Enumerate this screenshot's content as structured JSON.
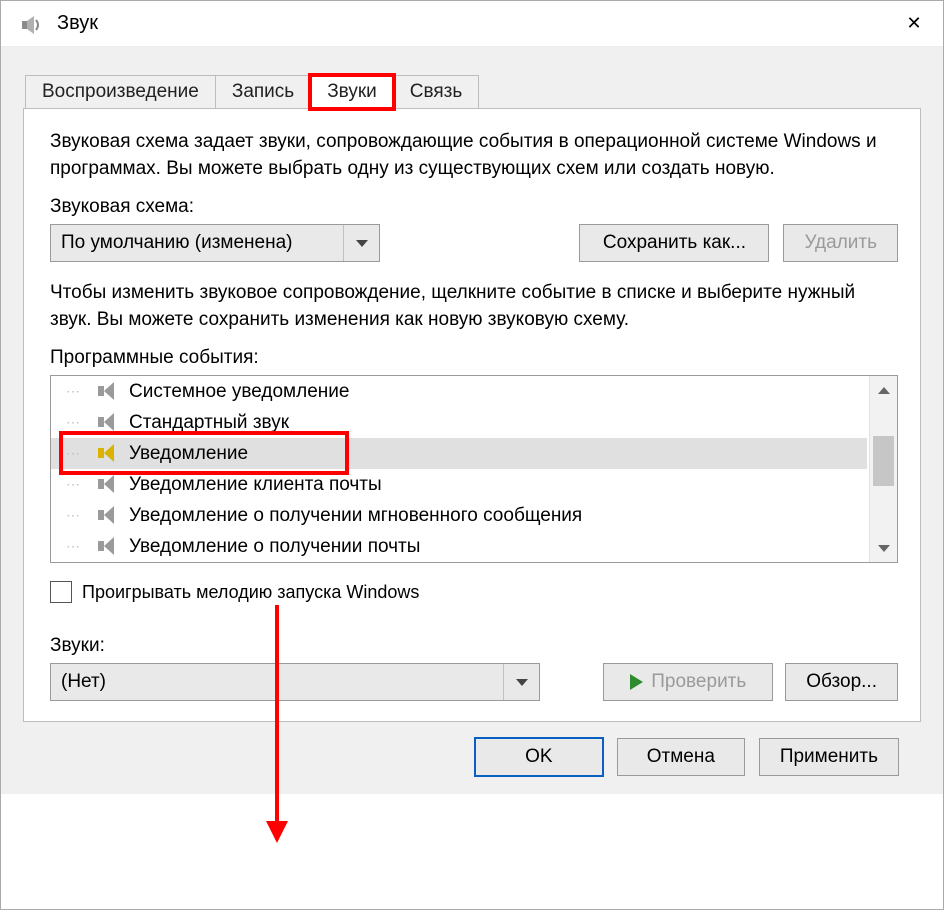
{
  "window": {
    "title": "Звук"
  },
  "tabs": {
    "playback": "Воспроизведение",
    "recording": "Запись",
    "sounds": "Звуки",
    "comm": "Связь"
  },
  "panel": {
    "intro": "Звуковая схема задает звуки, сопровождающие события в операционной системе Windows и программах. Вы можете выбрать одну из существующих схем или создать новую.",
    "scheme_label": "Звуковая схема:",
    "scheme_value": "По умолчанию (изменена)",
    "save_as": "Сохранить как...",
    "delete": "Удалить",
    "events_intro": "Чтобы изменить звуковое сопровождение, щелкните событие в списке и выберите нужный звук. Вы можете сохранить изменения как новую звуковую схему.",
    "events_label": "Программные события:",
    "events": [
      "Системное уведомление",
      "Стандартный звук",
      "Уведомление",
      "Уведомление клиента почты",
      "Уведомление о получении мгновенного сообщения",
      "Уведомление о получении почты"
    ],
    "play_startup": "Проигрывать мелодию запуска Windows",
    "sounds_label": "Звуки:",
    "sound_value": "(Нет)",
    "test": "Проверить",
    "browse": "Обзор..."
  },
  "footer": {
    "ok": "OK",
    "cancel": "Отмена",
    "apply": "Применить"
  }
}
